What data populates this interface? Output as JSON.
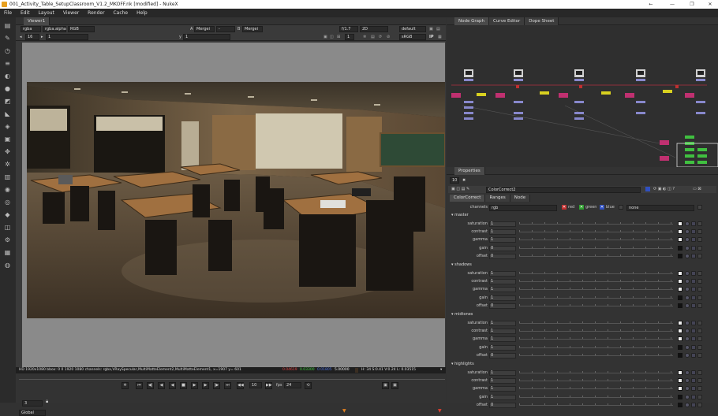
{
  "window": {
    "title": "001_Activity_Table_SetupClassroom_V1.2_MKOFF.nk [modified] - NukeX",
    "buttons": {
      "back": "←",
      "minimize": "—",
      "restore": "❐",
      "close": "✕"
    }
  },
  "menu": [
    "File",
    "Edit",
    "Layout",
    "Viewer",
    "Render",
    "Cache",
    "Help"
  ],
  "viewer": {
    "tab": "Viewer1",
    "row1": {
      "channels": "rgba",
      "alpha": "rgba.alpha",
      "colorspace": "RGB",
      "a_label": "A",
      "a_node": "Mergei",
      "a_op": "-",
      "b_label": "B",
      "b_node": "Mergei",
      "gain": "f/1.7",
      "mode": "2D",
      "lut": "default"
    },
    "row2": {
      "frame_left": "16",
      "zoom_left": "1",
      "y_label": "y",
      "y_value": "1",
      "frame_right": "1",
      "view_transform": "sRGB"
    },
    "status": {
      "info": "HD 1920x1080 bbox: 0 0 1920 1080 channels: rgba,VRaySpecular,MultiMatteElement2,MultiMatteElement1, x=1907 y= 601",
      "r": "0.04619",
      "g": "0.03300",
      "b": "0.01805",
      "a": "5.00000",
      "hsvl": "H: 34 S:0.41 V:0.24 L: 0.03515"
    },
    "playback": {
      "frame": "3",
      "increment": "10",
      "fps_label": "fps",
      "fps": "24",
      "range": "Global"
    }
  },
  "nodegraph": {
    "tabs": [
      "Node Graph",
      "Curve Editor",
      "Dope Sheet"
    ]
  },
  "properties": {
    "tab": "Properties",
    "count": "10",
    "node_name": "ColorCorrect2",
    "subtabs": [
      "ColorCorrect",
      "Ranges",
      "Node"
    ],
    "channels_label": "channels",
    "channels_value": "rgb",
    "ch_red": "red",
    "ch_green": "green",
    "ch_blue": "blue",
    "ch_none": "none",
    "groups": [
      {
        "name": "master",
        "rows": [
          {
            "label": "saturation",
            "value": "1"
          },
          {
            "label": "contrast",
            "value": "1"
          },
          {
            "label": "gamma",
            "value": "1"
          },
          {
            "label": "gain",
            "value": "0"
          },
          {
            "label": "offset",
            "value": "0"
          }
        ]
      },
      {
        "name": "shadows",
        "rows": [
          {
            "label": "saturation",
            "value": "1"
          },
          {
            "label": "contrast",
            "value": "1"
          },
          {
            "label": "gamma",
            "value": "1"
          },
          {
            "label": "gain",
            "value": "1"
          },
          {
            "label": "offset",
            "value": "0"
          }
        ]
      },
      {
        "name": "midtones",
        "rows": [
          {
            "label": "saturation",
            "value": "1"
          },
          {
            "label": "contrast",
            "value": "1"
          },
          {
            "label": "gamma",
            "value": "1"
          },
          {
            "label": "gain",
            "value": "1"
          },
          {
            "label": "offset",
            "value": "0"
          }
        ]
      },
      {
        "name": "highlights",
        "rows": [
          {
            "label": "saturation",
            "value": "1"
          },
          {
            "label": "contrast",
            "value": "1"
          },
          {
            "label": "gamma",
            "value": "1"
          },
          {
            "label": "gain",
            "value": "1"
          },
          {
            "label": "offset",
            "value": "0"
          }
        ]
      }
    ]
  },
  "colors": {
    "accent_red": "#cc3030",
    "accent_green": "#40c040",
    "accent_blue": "#4060d0",
    "node_yellow": "#d8d020",
    "node_pink": "#c04080"
  }
}
